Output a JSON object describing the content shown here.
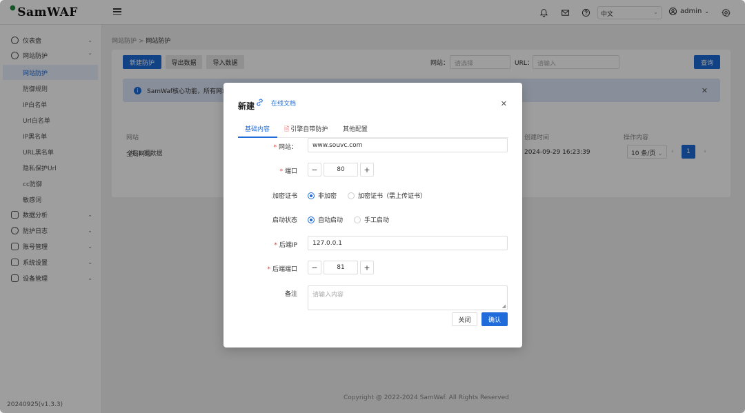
{
  "app": {
    "logo_text": "SamWAF",
    "version": "20240925(v1.3.3)"
  },
  "topbar": {
    "language": "中文",
    "user": "admin"
  },
  "sidebar": {
    "items": [
      {
        "label": "仪表盘"
      },
      {
        "label": "网站防护"
      },
      {
        "label": "数据分析"
      },
      {
        "label": "防护日志"
      },
      {
        "label": "账号管理"
      },
      {
        "label": "系统设置"
      },
      {
        "label": "设备管理"
      }
    ],
    "subitems": [
      {
        "label": "网站防护"
      },
      {
        "label": "防御规则"
      },
      {
        "label": "IP白名单"
      },
      {
        "label": "Url白名单"
      },
      {
        "label": "IP黑名单"
      },
      {
        "label": "URL黑名单"
      },
      {
        "label": "隐私保护Url"
      },
      {
        "label": "cc防御"
      },
      {
        "label": "敏感词"
      }
    ]
  },
  "breadcrumb": {
    "parent": "网站防护",
    "current": "网站防护"
  },
  "toolbar": {
    "new_label": "新建防护",
    "export_label": "导出数据",
    "import_label": "导入数据",
    "site_label": "网站：",
    "site_placeholder": "请选择",
    "url_label": "URL：",
    "url_placeholder": "请输入",
    "query_label": "查询"
  },
  "info_bar": {
    "text": "SamWaf核心功能，所有网站"
  },
  "table": {
    "headers": {
      "site": "网站",
      "created": "创建时间",
      "ops": "操作内容"
    },
    "rows": [
      {
        "site": "全局网站",
        "created": "2024-09-29 16:23:39"
      }
    ],
    "total": "共 1 项数据"
  },
  "pager": {
    "size": "10 条/页",
    "current": "1"
  },
  "footer": {
    "text": "Copyright @ 2022-2024 SamWaf. All Rights Reserved"
  },
  "dialog": {
    "title": "新建",
    "doc_link": "在线文档",
    "tabs": [
      {
        "label": "基础内容"
      },
      {
        "label": "引擎自带防护"
      },
      {
        "label": "其他配置"
      }
    ],
    "form": {
      "site_label": "网站：",
      "site_value": "www.souvc.com",
      "port_label": "端口",
      "port_value": "80",
      "ssl_label": "加密证书",
      "ssl_options": [
        "非加密",
        "加密证书（需上传证书）"
      ],
      "start_label": "启动状态",
      "start_options": [
        "自动启动",
        "手工启动"
      ],
      "backend_ip_label": "后端IP",
      "backend_ip_value": "127.0.0.1",
      "backend_port_label": "后端端口",
      "backend_port_value": "81",
      "remark_label": "备注",
      "remark_placeholder": "请输入内容"
    },
    "cancel_label": "关闭",
    "ok_label": "确认"
  }
}
